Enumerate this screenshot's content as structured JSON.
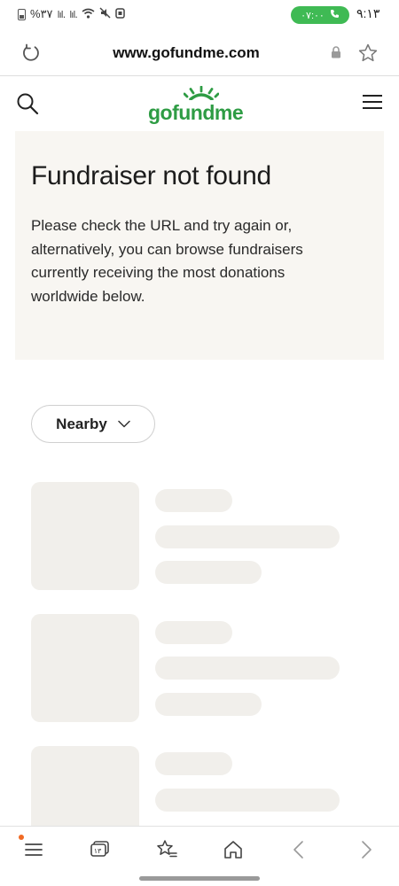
{
  "status_bar": {
    "battery_text": "%۳۷",
    "call_timer": "۰۷:۰۰",
    "clock": "۹:۱۳"
  },
  "address_bar": {
    "url": "www.gofundme.com"
  },
  "site_header": {
    "logo_text": "gofundme",
    "brand_color": "#2e9c44"
  },
  "notfound": {
    "title": "Fundraiser not found",
    "message": "Please check the URL and try again or, alternatively, you can browse fundraisers currently receiving the most donations worldwide below."
  },
  "filter": {
    "nearby_label": "Nearby"
  },
  "bottom_nav": {
    "tab_count": "۱۳",
    "items": [
      "menu-icon",
      "tabs-icon",
      "favorites-icon",
      "home-icon",
      "back-icon",
      "forward-icon"
    ]
  }
}
